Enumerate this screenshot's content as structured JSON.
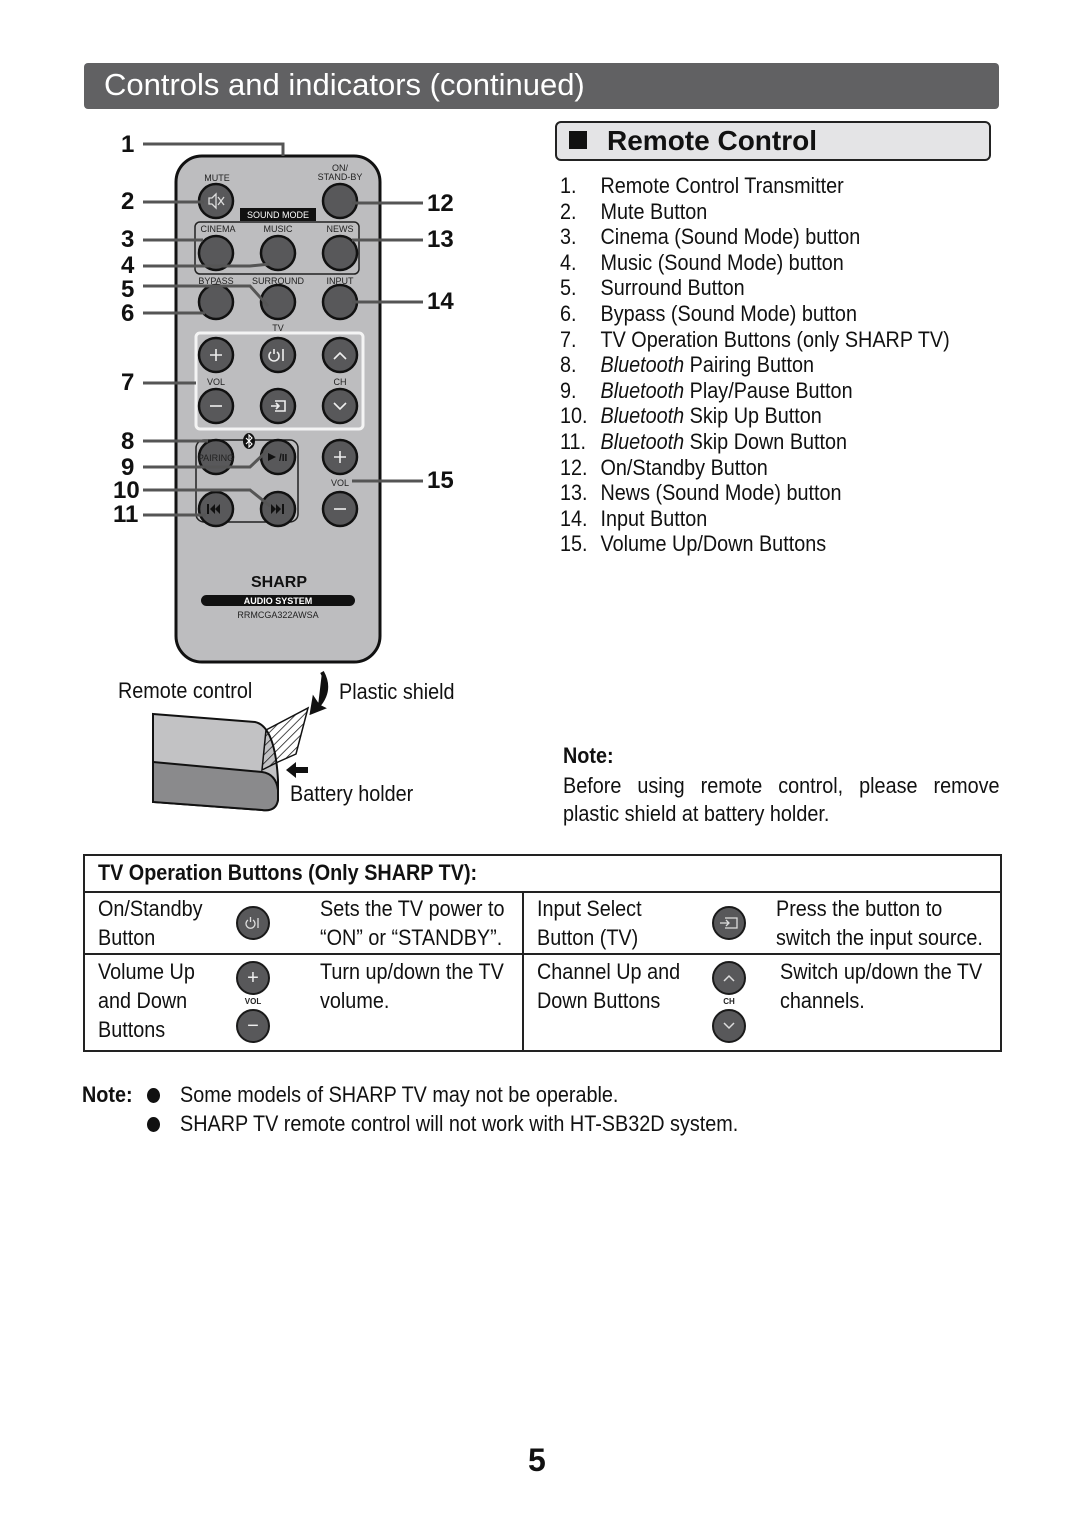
{
  "header": {
    "title": "Controls and indicators (continued)"
  },
  "remote_section": {
    "title": "Remote Control",
    "items": [
      {
        "num": "1.",
        "italic": "",
        "text": "Remote Control Transmitter"
      },
      {
        "num": "2.",
        "italic": "",
        "text": "Mute Button"
      },
      {
        "num": "3.",
        "italic": "",
        "text": "Cinema (Sound Mode) button"
      },
      {
        "num": "4.",
        "italic": "",
        "text": "Music (Sound Mode) button"
      },
      {
        "num": "5.",
        "italic": "",
        "text": "Surround Button"
      },
      {
        "num": "6.",
        "italic": "",
        "text": "Bypass (Sound Mode) button"
      },
      {
        "num": "7.",
        "italic": "",
        "text": "TV Operation Buttons (only SHARP TV)"
      },
      {
        "num": "8.",
        "italic": "Bluetooth",
        "text": " Pairing Button"
      },
      {
        "num": "9.",
        "italic": "Bluetooth",
        "text": " Play/Pause Button"
      },
      {
        "num": "10.",
        "italic": "Bluetooth",
        "text": " Skip Up Button"
      },
      {
        "num": "11.",
        "italic": "Bluetooth",
        "text": " Skip Down Button"
      },
      {
        "num": "12.",
        "italic": "",
        "text": "On/Standby Button"
      },
      {
        "num": "13.",
        "italic": "",
        "text": "News (Sound Mode) button"
      },
      {
        "num": "14.",
        "italic": "",
        "text": "Input Button"
      },
      {
        "num": "15.",
        "italic": "",
        "text": "Volume Up/Down Buttons"
      }
    ]
  },
  "remote_diagram": {
    "callouts": [
      "1",
      "2",
      "3",
      "4",
      "5",
      "6",
      "7",
      "8",
      "9",
      "10",
      "11",
      "12",
      "13",
      "14",
      "15"
    ],
    "labels": {
      "mute": "MUTE",
      "on_standby": "ON/\nSTAND-BY",
      "sound_mode": "SOUND MODE",
      "cinema": "CINEMA",
      "music": "MUSIC",
      "news": "NEWS",
      "bypass": "BYPASS",
      "surround": "SURROUND",
      "input": "INPUT",
      "tv": "TV",
      "vol": "VOL",
      "ch": "CH",
      "pairing": "PAIRING",
      "play_pause": "►/II",
      "brand": "SHARP",
      "system": "AUDIO SYSTEM",
      "model": "RRMCGA322AWSA"
    }
  },
  "battery_diagram": {
    "remote_label": "Remote control",
    "shield_label": "Plastic shield",
    "holder_label": "Battery holder"
  },
  "note": {
    "heading": "Note:",
    "body": "Before using remote control, please remove plastic shield at battery holder."
  },
  "tv_table": {
    "title": "TV Operation Buttons (Only SHARP TV):",
    "rows": [
      [
        {
          "name": "On/Standby\nButton",
          "icon": "power-icon",
          "desc": "Sets the TV power to\n“ON” or “STANDBY”."
        },
        {
          "name": "Input Select\nButton (TV)",
          "icon": "input-icon",
          "desc": "Press the button to\nswitch the input source."
        }
      ],
      [
        {
          "name": "Volume Up\nand Down\nButtons",
          "icon": "volume-icon",
          "icon_label": "VOL",
          "desc": "Turn up/down the TV\nvolume."
        },
        {
          "name": "Channel Up and\nDown Buttons",
          "icon": "channel-icon",
          "icon_label": "CH",
          "desc": "Switch up/down the TV\nchannels."
        }
      ]
    ]
  },
  "bottom_note": {
    "label": "Note:",
    "bullets": [
      "Some models of SHARP TV may not be operable.",
      "SHARP TV remote control will not work with HT-SB32D system."
    ]
  },
  "page_number": "5",
  "colors": {
    "banner": "#616163",
    "remote_body": "#bdbdbf",
    "button": "#58585a",
    "heading_box": "#e4e4e6"
  }
}
